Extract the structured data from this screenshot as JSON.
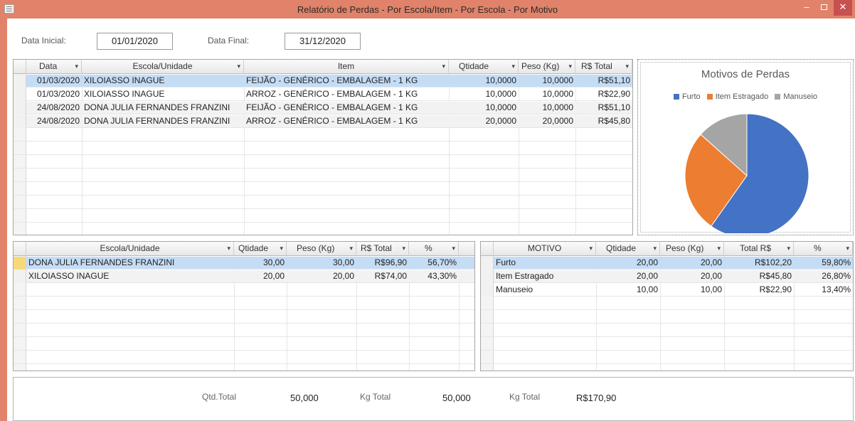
{
  "window": {
    "title": "Relatório de Perdas - Por Escola/Item - Por Escola - Por Motivo"
  },
  "filters": {
    "data_inicial_label": "Data Inicial:",
    "data_inicial_value": "01/01/2020",
    "data_final_label": "Data Final:",
    "data_final_value": "31/12/2020"
  },
  "main_grid": {
    "headers": [
      "Data",
      "Escola/Unidade",
      "Item",
      "Qtidade",
      "Peso (Kg)",
      "R$ Total"
    ],
    "rows": [
      [
        "01/03/2020",
        "XILOIASSO INAGUE",
        "FEIJÃO - GENÉRICO - EMBALAGEM - 1 KG",
        "10,0000",
        "10,0000",
        "R$51,10"
      ],
      [
        "01/03/2020",
        "XILOIASSO INAGUE",
        "ARROZ - GENÉRICO - EMBALAGEM - 1 KG",
        "10,0000",
        "10,0000",
        "R$22,90"
      ],
      [
        "24/08/2020",
        "DONA JULIA FERNANDES FRANZINI",
        "FEIJÃO - GENÉRICO - EMBALAGEM - 1 KG",
        "10,0000",
        "10,0000",
        "R$51,10"
      ],
      [
        "24/08/2020",
        "DONA JULIA FERNANDES FRANZINI",
        "ARROZ - GENÉRICO - EMBALAGEM - 1 KG",
        "20,0000",
        "20,0000",
        "R$45,80"
      ]
    ]
  },
  "escola_grid": {
    "headers": [
      "Escola/Unidade",
      "Qtidade",
      "Peso (Kg)",
      "R$ Total",
      "%"
    ],
    "rows": [
      [
        "DONA JULIA FERNANDES FRANZINI",
        "30,00",
        "30,00",
        "R$96,90",
        "56,70%"
      ],
      [
        "XILOIASSO INAGUE",
        "20,00",
        "20,00",
        "R$74,00",
        "43,30%"
      ]
    ]
  },
  "motivo_grid": {
    "headers": [
      "MOTIVO",
      "Qtidade",
      "Peso (Kg)",
      "Total R$",
      "%"
    ],
    "rows": [
      [
        "Furto",
        "20,00",
        "20,00",
        "R$102,20",
        "59,80%"
      ],
      [
        "Item Estragado",
        "20,00",
        "20,00",
        "R$45,80",
        "26,80%"
      ],
      [
        "Manuseio",
        "10,00",
        "10,00",
        "R$22,90",
        "13,40%"
      ]
    ]
  },
  "chart_data": {
    "type": "pie",
    "title": "Motivos de Perdas",
    "categories": [
      "Furto",
      "Item Estragado",
      "Manuseio"
    ],
    "values": [
      59.8,
      26.8,
      13.4
    ],
    "colors": [
      "#4472c4",
      "#ed7d31",
      "#a5a5a5"
    ],
    "legend": "top"
  },
  "totals": {
    "qtd_label": "Qtd.Total",
    "qtd_value": "50,000",
    "kg_label": "Kg Total",
    "kg_value": "50,000",
    "total_label": "Kg Total",
    "total_value": "R$170,90"
  }
}
